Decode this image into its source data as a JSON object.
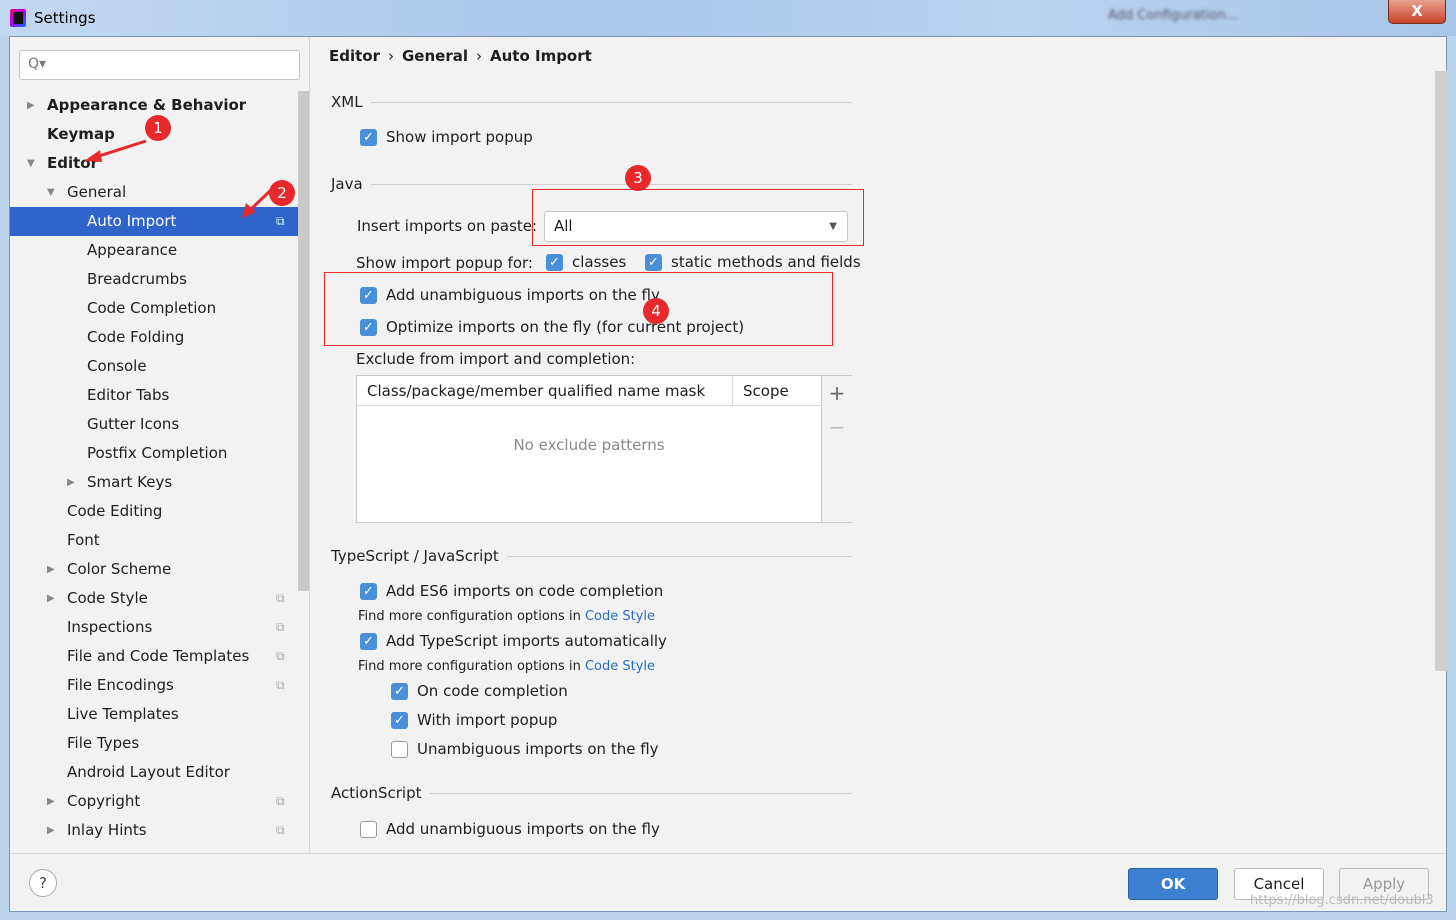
{
  "window": {
    "title": "Settings",
    "toolbar_blurred": "Add Configuration..."
  },
  "search": {
    "placeholder": "Q▾"
  },
  "sidebar": {
    "items": [
      {
        "label": "Appearance & Behavior",
        "level": 0,
        "arrow": "right",
        "bold": true
      },
      {
        "label": "Keymap",
        "level": 0,
        "bold": true
      },
      {
        "label": "Editor",
        "level": 0,
        "arrow": "down",
        "bold": true
      },
      {
        "label": "General",
        "level": 1,
        "arrow": "down"
      },
      {
        "label": "Auto Import",
        "level": 2,
        "selected": true,
        "copy": true
      },
      {
        "label": "Appearance",
        "level": 2
      },
      {
        "label": "Breadcrumbs",
        "level": 2
      },
      {
        "label": "Code Completion",
        "level": 2
      },
      {
        "label": "Code Folding",
        "level": 2
      },
      {
        "label": "Console",
        "level": 2
      },
      {
        "label": "Editor Tabs",
        "level": 2
      },
      {
        "label": "Gutter Icons",
        "level": 2
      },
      {
        "label": "Postfix Completion",
        "level": 2
      },
      {
        "label": "Smart Keys",
        "level": 2,
        "arrow": "right"
      },
      {
        "label": "Code Editing",
        "level": 1
      },
      {
        "label": "Font",
        "level": 1
      },
      {
        "label": "Color Scheme",
        "level": 1,
        "arrow": "right"
      },
      {
        "label": "Code Style",
        "level": 1,
        "arrow": "right",
        "copy": true
      },
      {
        "label": "Inspections",
        "level": 1,
        "copy": true
      },
      {
        "label": "File and Code Templates",
        "level": 1,
        "copy": true
      },
      {
        "label": "File Encodings",
        "level": 1,
        "copy": true
      },
      {
        "label": "Live Templates",
        "level": 1
      },
      {
        "label": "File Types",
        "level": 1
      },
      {
        "label": "Android Layout Editor",
        "level": 1
      },
      {
        "label": "Copyright",
        "level": 1,
        "arrow": "right",
        "copy": true
      },
      {
        "label": "Inlay Hints",
        "level": 1,
        "arrow": "right",
        "copy": true
      }
    ]
  },
  "breadcrumb": [
    "Editor",
    "General",
    "Auto Import"
  ],
  "xml": {
    "title": "XML",
    "show_popup": "Show import popup"
  },
  "java": {
    "title": "Java",
    "insert_label": "Insert imports on paste:",
    "insert_value": "All",
    "popup_for": "Show import popup for:",
    "classes": "classes",
    "static": "static methods and fields",
    "add_unamb": "Add unambiguous imports on the fly",
    "optimize": "Optimize imports on the fly (for current project)",
    "exclude_label": "Exclude from import and completion:",
    "col_mask": "Class/package/member qualified name mask",
    "col_scope": "Scope",
    "empty": "No exclude patterns",
    "add": "+",
    "remove": "−"
  },
  "ts": {
    "title": "TypeScript / JavaScript",
    "es6": "Add ES6 imports on code completion",
    "more": "Find more configuration options in",
    "code_style": "Code Style",
    "ts_auto": "Add TypeScript imports automatically",
    "on_completion": "On code completion",
    "with_popup": "With import popup",
    "unamb": "Unambiguous imports on the fly"
  },
  "as": {
    "title": "ActionScript",
    "unamb": "Add unambiguous imports on the fly"
  },
  "markers": [
    "1",
    "2",
    "3",
    "4"
  ],
  "footer": {
    "help": "?",
    "ok": "OK",
    "cancel": "Cancel",
    "apply": "Apply"
  },
  "watermark": "https://blog.csdn.net/doubl3",
  "colors": {
    "accent": "#2f65ca",
    "checkbox": "#4a90d9",
    "annotation": "#e8282a"
  }
}
